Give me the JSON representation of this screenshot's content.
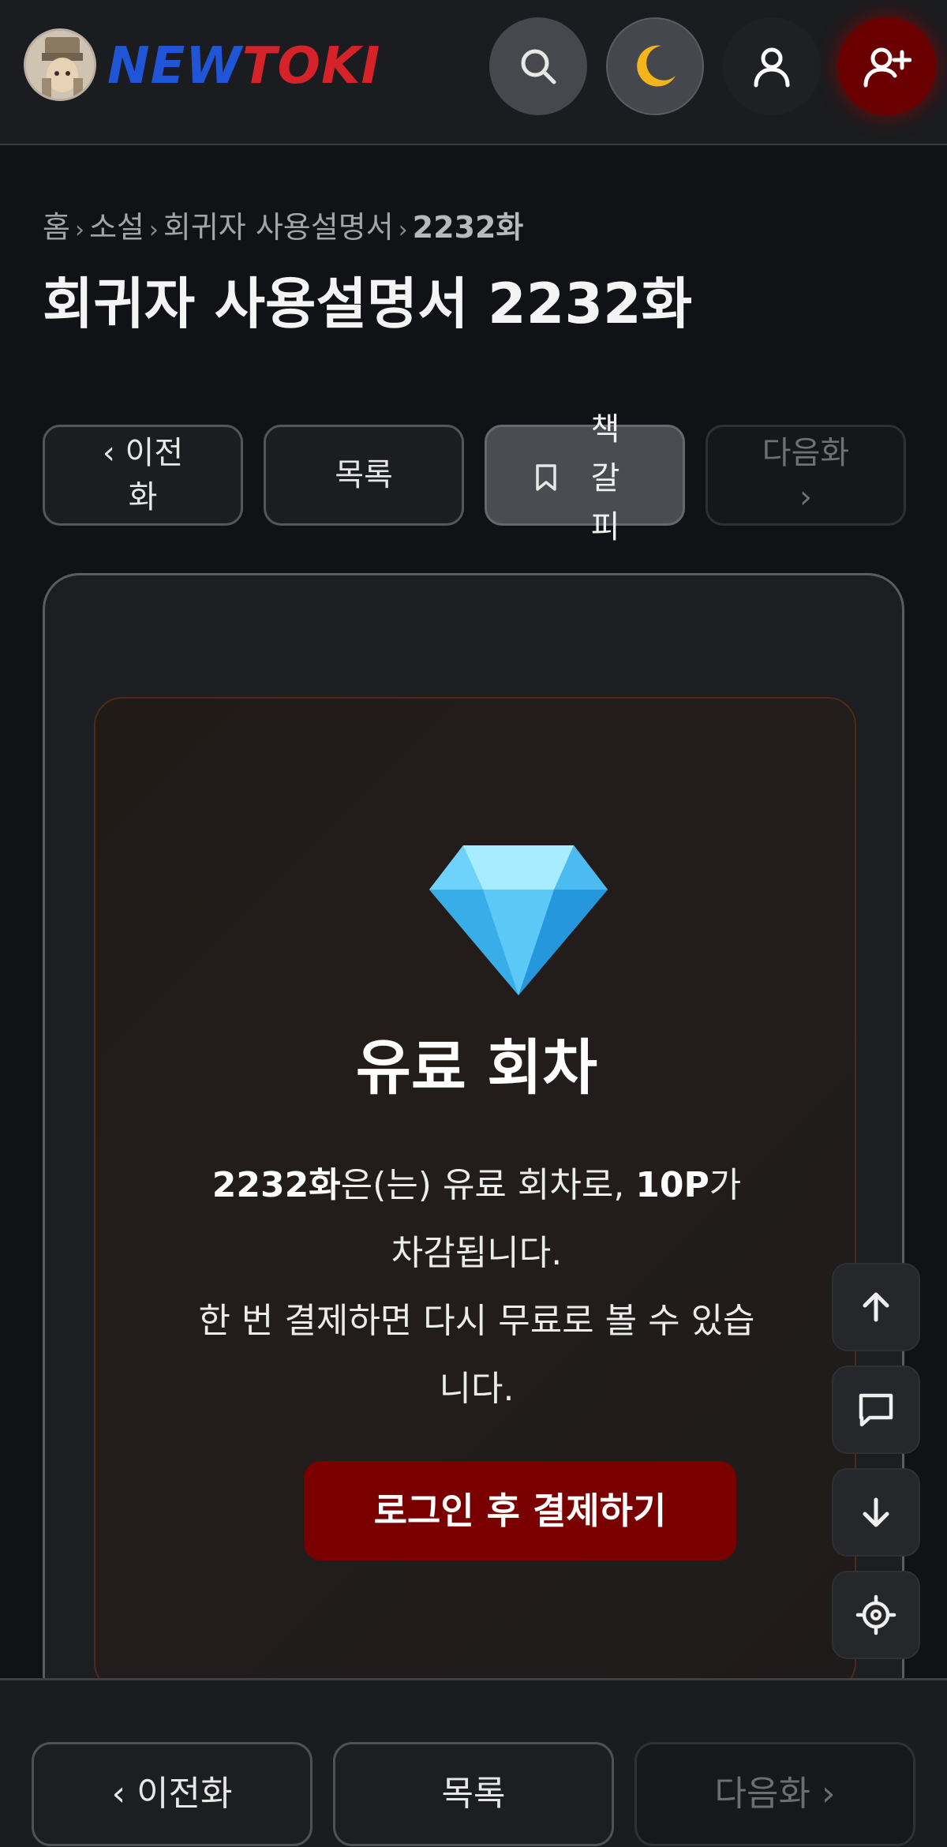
{
  "header": {
    "logo_new": "NEW",
    "logo_toki": "TOKI",
    "icons": [
      "avatar",
      "search-icon",
      "moon-icon",
      "user-icon",
      "user-plus-icon"
    ]
  },
  "breadcrumb": {
    "home": "홈",
    "category": "소설",
    "series": "회귀자 사용설명서",
    "current": "2232화",
    "separator": "›"
  },
  "title": "회귀자 사용설명서 2232화",
  "nav": {
    "prev_label": "‹ 이전화",
    "list_label": "목록",
    "bookmark_label": "책갈피",
    "next_label": "다음화 ›"
  },
  "paid": {
    "heading": "유료 회차",
    "episode": "2232화",
    "text_1": "은(는) 유료 회차로, ",
    "points": "10P",
    "text_2": "가 차감됩니다.",
    "text_3": "한 번 결제하면 다시 무료로 볼 수 있습니다.",
    "button": "로그인 후 결제하기"
  },
  "side_buttons": [
    "arrow-up-icon",
    "comment-icon",
    "arrow-down-icon",
    "settings-icon"
  ],
  "bottom_nav": {
    "prev_label": "‹ 이전화",
    "list_label": "목록",
    "next_label": "다음화 ›"
  },
  "colors": {
    "background": "#101215",
    "accent_red": "#7a0000",
    "logo_blue": "#1f55d6",
    "logo_red": "#d6232a"
  }
}
